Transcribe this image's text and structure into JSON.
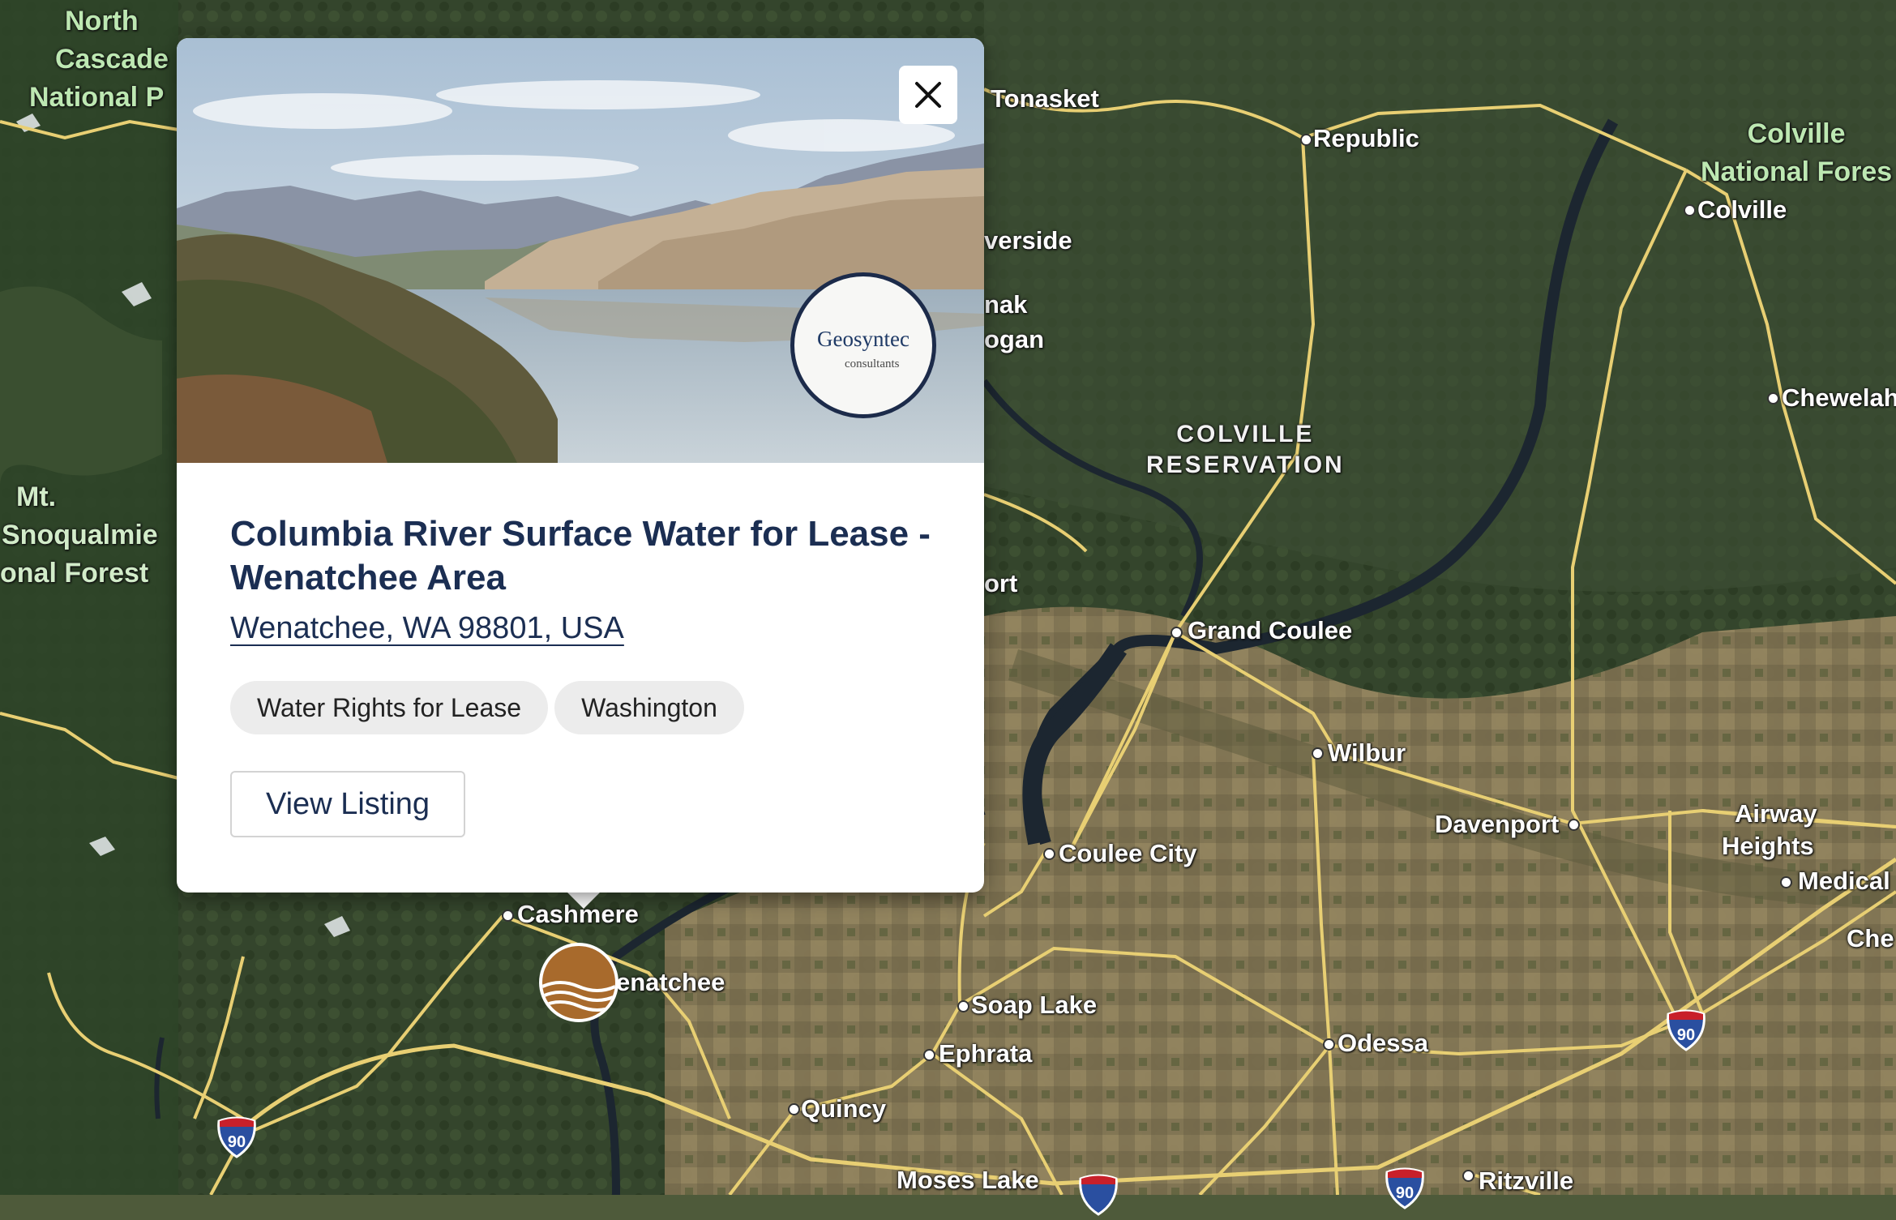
{
  "map": {
    "base_color": "#5a6040",
    "places": {
      "tonasket": "Tonasket",
      "republic": "Republic",
      "colville": "Colville",
      "chewelah": "Chewelah",
      "riverside": "verside",
      "omak": "nak",
      "okanogan": "ogan",
      "bridgeport": "ort",
      "grand_coulee": "Grand Coulee",
      "wilbur": "Wilbur",
      "davenport": "Davenport",
      "airway_heights_1": "Airway",
      "airway_heights_2": "Heights",
      "medical": "Medical",
      "cheney": "Che",
      "coulee_city": "Coulee City",
      "cashmere": "Cashmere",
      "wenatchee": "enatchee",
      "soap_lake": "Soap Lake",
      "ephrata": "Ephrata",
      "odessa": "Odessa",
      "quincy": "Quincy",
      "moses_lake": "Moses Lake",
      "ritzville": "Ritzville"
    },
    "parks": {
      "north_cascades": [
        "North",
        "Cascade",
        "National P"
      ],
      "colville_forest": [
        "Colville",
        "National Fores"
      ],
      "snoqualmie": [
        "Mt.",
        "Snoqualmie",
        "onal Forest"
      ]
    },
    "reservation": [
      "COLVILLE",
      "RESERVATION"
    ],
    "interstate": "90"
  },
  "popup": {
    "close_icon": "close-icon",
    "logo": {
      "name": "Geosyntec",
      "sub": "consultants"
    },
    "title": "Columbia River Surface Water for Lease - Wenatchee Area",
    "address": "Wenatchee, WA 98801, USA",
    "tags": [
      "Water Rights for Lease",
      "Washington"
    ],
    "view_button": "View Listing"
  },
  "colors": {
    "title": "#1b2e52",
    "marker": "#a86a2c",
    "road": "#e8cf73"
  }
}
